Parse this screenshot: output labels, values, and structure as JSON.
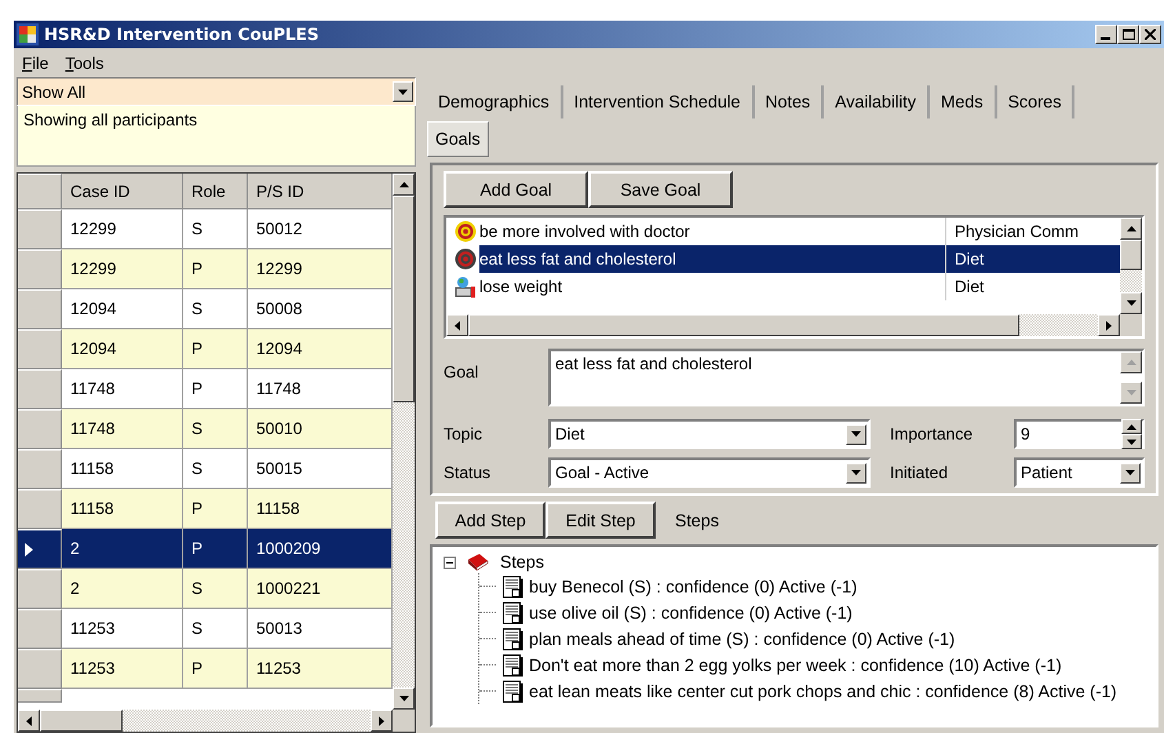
{
  "window": {
    "title": "HSR&D Intervention CouPLES"
  },
  "menu": [
    {
      "label": "File"
    },
    {
      "label": "Tools"
    }
  ],
  "filter": {
    "value": "Show All",
    "description": "Showing all participants"
  },
  "grid": {
    "columns": [
      "Case ID",
      "Role",
      "P/S ID"
    ],
    "rows": [
      {
        "cells": [
          "12299",
          "S",
          "50012"
        ],
        "selected": false
      },
      {
        "cells": [
          "12299",
          "P",
          "12299"
        ],
        "selected": false
      },
      {
        "cells": [
          "12094",
          "S",
          "50008"
        ],
        "selected": false
      },
      {
        "cells": [
          "12094",
          "P",
          "12094"
        ],
        "selected": false
      },
      {
        "cells": [
          "11748",
          "P",
          "11748"
        ],
        "selected": false
      },
      {
        "cells": [
          "11748",
          "S",
          "50010"
        ],
        "selected": false
      },
      {
        "cells": [
          "11158",
          "S",
          "50015"
        ],
        "selected": false
      },
      {
        "cells": [
          "11158",
          "P",
          "11158"
        ],
        "selected": false
      },
      {
        "cells": [
          "2",
          "P",
          "1000209"
        ],
        "selected": true
      },
      {
        "cells": [
          "2",
          "S",
          "1000221"
        ],
        "selected": false
      },
      {
        "cells": [
          "11253",
          "S",
          "50013"
        ],
        "selected": false
      },
      {
        "cells": [
          "11253",
          "P",
          "11253"
        ],
        "selected": false
      }
    ]
  },
  "tabs": [
    {
      "label": "Demographics",
      "selected": false
    },
    {
      "label": "Intervention Schedule",
      "selected": false
    },
    {
      "label": "Notes",
      "selected": false
    },
    {
      "label": "Availability",
      "selected": false
    },
    {
      "label": "Meds",
      "selected": false
    },
    {
      "label": "Scores",
      "selected": false
    },
    {
      "label": "Goals",
      "selected": true
    }
  ],
  "goal_buttons": [
    "Add Goal",
    "Save Goal"
  ],
  "goals": [
    {
      "kind": "target",
      "name": "be more involved with doctor",
      "topic": "Physician Comm",
      "selected": false
    },
    {
      "kind": "target",
      "name": "eat less fat and cholesterol",
      "topic": "Diet",
      "selected": true
    },
    {
      "kind": "scale",
      "name": "lose weight",
      "topic": "Diet",
      "selected": false
    }
  ],
  "goal_form": {
    "goal_label": "Goal",
    "goal": "eat less fat and cholesterol",
    "topic_label": "Topic",
    "topic": "Diet",
    "status_label": "Status",
    "status": "Goal - Active",
    "importance_label": "Importance",
    "importance": "9",
    "initiated_label": "Initiated",
    "initiated": "Patient"
  },
  "step_buttons": [
    "Add Step",
    "Edit Step"
  ],
  "steps_label": "Steps",
  "steps_tree": {
    "label": "Steps",
    "expanded": true,
    "children": [
      {
        "label": "buy Benecol  (S) : confidence (0) Active (-1)"
      },
      {
        "label": "use olive oil  (S) : confidence (0) Active (-1)"
      },
      {
        "label": "plan meals ahead of time (S) : confidence (0) Active (-1)"
      },
      {
        "label": "Don't eat more than 2 egg yolks per week : confidence (10) Active (-1)"
      },
      {
        "label": "eat lean meats like center cut pork chops and chic : confidence (8) Active (-1)"
      }
    ]
  }
}
